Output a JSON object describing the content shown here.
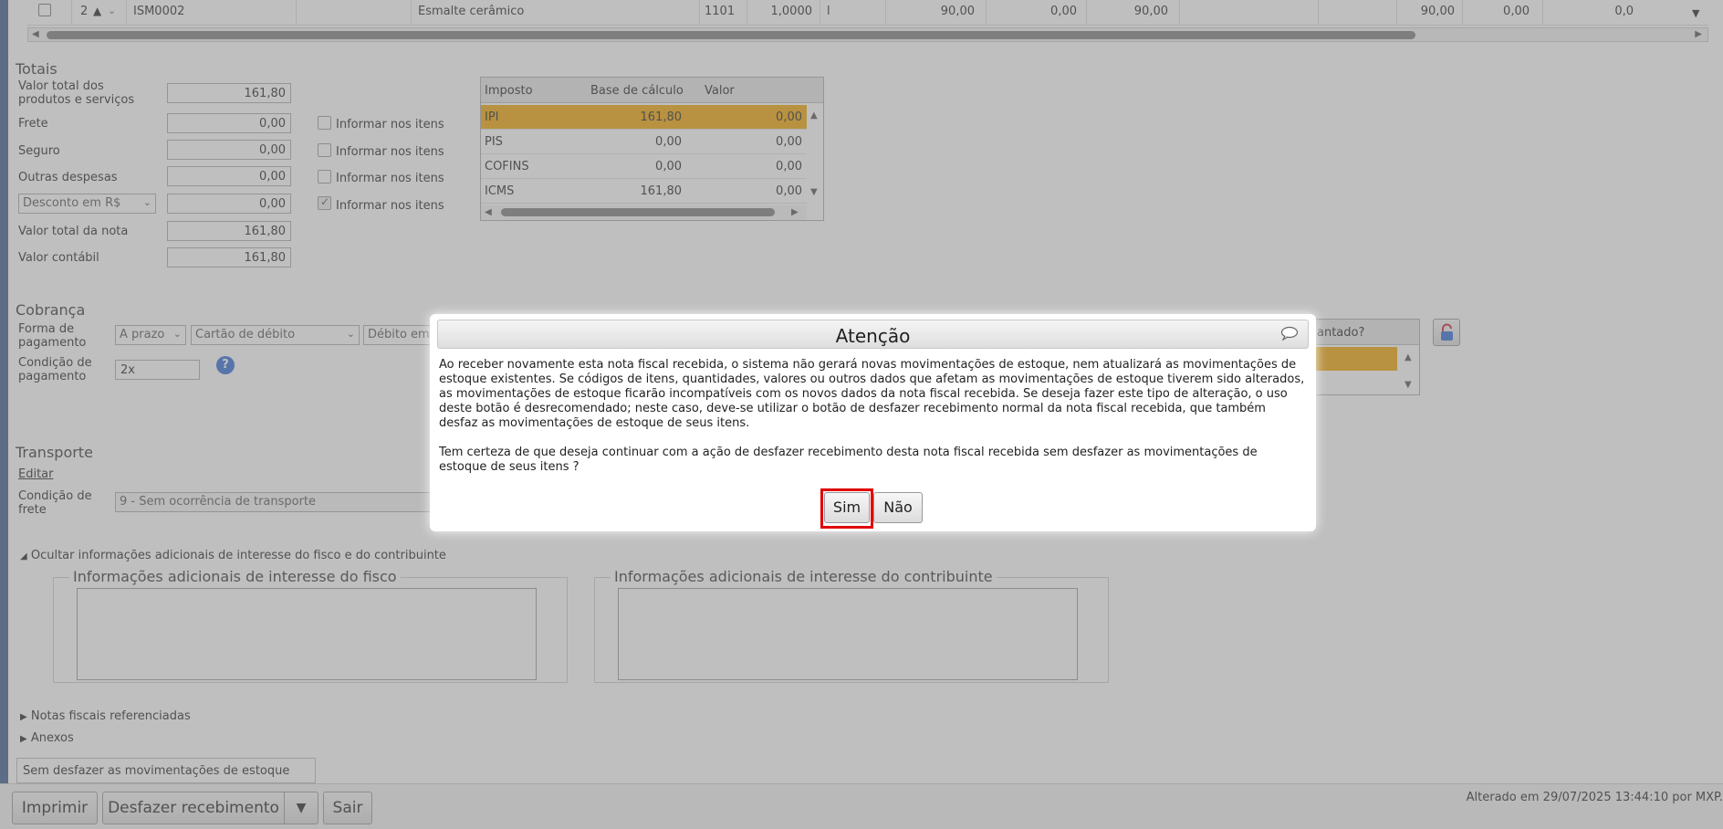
{
  "grid_row": {
    "seq": "2",
    "code": "ISM0002",
    "description": "Esmalte cerâmico",
    "cfop": "1101",
    "quantity": "1,0000",
    "unit": "l",
    "unit_value": "90,00",
    "discount": "0,00",
    "total": "90,00",
    "value_b": "90,00",
    "value_c": "0,00",
    "value_d": "0,0"
  },
  "totais": {
    "title": "Totais",
    "valor_total_label": "Valor total dos produtos e serviços",
    "valor_total_value": "161,80",
    "frete_label": "Frete",
    "frete_value": "0,00",
    "seguro_label": "Seguro",
    "seguro_value": "0,00",
    "outras_label": "Outras despesas",
    "outras_value": "0,00",
    "desconto_select": "Desconto em R$",
    "desconto_value": "0,00",
    "valor_nota_label": "Valor total da nota",
    "valor_nota_value": "161,80",
    "valor_contabil_label": "Valor contábil",
    "valor_contabil_value": "161,80",
    "informar_label": "Informar nos itens"
  },
  "tax_table": {
    "headers": [
      "Imposto",
      "Base de cálculo",
      "Valor"
    ],
    "rows": [
      {
        "imposto": "IPI",
        "base": "161,80",
        "valor": "0,00"
      },
      {
        "imposto": "PIS",
        "base": "0,00",
        "valor": "0,00"
      },
      {
        "imposto": "COFINS",
        "base": "0,00",
        "valor": "0,00"
      },
      {
        "imposto": "ICMS",
        "base": "161,80",
        "valor": "0,00"
      }
    ]
  },
  "cobranca": {
    "title": "Cobrança",
    "forma_label": "Forma de pagamento",
    "forma_select1": "A prazo",
    "forma_select2": "Cartão de débito",
    "forma_select3": "Débito em",
    "condicao_label": "Condição de pagamento",
    "condicao_value": "2x",
    "right_header": "antado?"
  },
  "transporte": {
    "title": "Transporte",
    "edit_link": "Editar",
    "condicao_frete_label": "Condição de frete",
    "condicao_frete_value": "9 - Sem ocorrência de transporte"
  },
  "info": {
    "toggle": "Ocultar informações adicionais de interesse do fisco e do contribuinte",
    "fisco_legend": "Informações adicionais de interesse do fisco",
    "contribuinte_legend": "Informações adicionais de interesse do contribuinte"
  },
  "expanders": {
    "notas": "Notas fiscais referenciadas",
    "anexos": "Anexos"
  },
  "tooltip": "Sem desfazer as movimentações de estoque",
  "footer": {
    "imprimir": "Imprimir",
    "desfazer": "Desfazer recebimento",
    "dropdown_arrow": "▼",
    "sair": "Sair",
    "status": "Alterado em 29/07/2025 13:44:10 por MXP."
  },
  "dialog": {
    "title": "Atenção",
    "paragraph1": "Ao receber novamente esta nota fiscal recebida, o sistema não gerará novas movimentações de estoque, nem atualizará as movimentações de estoque existentes. Se códigos de itens, quantidades, valores ou outros dados que afetam as movimentações de estoque tiverem sido alterados, as movimentações de estoque ficarão incompatíveis com os novos dados da nota fiscal recebida. Se deseja fazer este tipo de alteração, o uso deste botão é desrecomendado; neste caso, deve-se utilizar o botão de desfazer recebimento normal da nota fiscal recebida, que também desfaz as movimentações de estoque de seus itens.",
    "paragraph2": "Tem certeza de que deseja continuar com a ação de desfazer recebimento desta nota fiscal recebida sem desfazer as movimentações de estoque de seus itens ?",
    "yes": "Sim",
    "no": "Não"
  },
  "colors": {
    "selected_row": "#f0a500",
    "highlight": "#e00000",
    "help_icon": "#2f6bd6"
  },
  "icons": [
    "chat-bubble-icon",
    "help-icon",
    "lock-icon",
    "sort-up-icon",
    "sort-down-icon",
    "scroll-left-icon",
    "scroll-right-icon"
  ]
}
